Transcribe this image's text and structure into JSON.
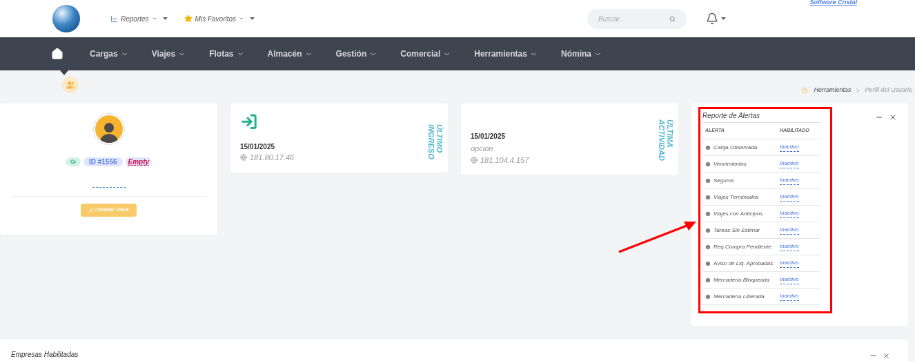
{
  "header": {
    "brand_caption": "Software Cristal",
    "quick_links": [
      {
        "label": "Reportes",
        "kind": "chart"
      },
      {
        "label": "Mis Favoritos",
        "kind": "star"
      }
    ],
    "search": {
      "placeholder": "Buscar..."
    }
  },
  "nav": {
    "items": [
      {
        "label": "Cargas"
      },
      {
        "label": "Viajes"
      },
      {
        "label": "Flotas"
      },
      {
        "label": "Almacén"
      },
      {
        "label": "Gestión"
      },
      {
        "label": "Comercial"
      },
      {
        "label": "Herramientas"
      },
      {
        "label": "Nómina"
      }
    ]
  },
  "breadcrumb": [
    "Herramientas",
    "Perfil del Usuario"
  ],
  "profile": {
    "id_badge": "ID #1556",
    "empty_badge": "Empty",
    "button": "Cambiar Clave"
  },
  "last_login": {
    "date": "15/01/2025",
    "ip": "181.80.17.46",
    "label_lines": [
      "ÚLTIMO",
      "INGRESO"
    ]
  },
  "last_activity": {
    "date": "15/01/2025",
    "detail": "opcion",
    "ip": "181.104.4.157",
    "label_lines": [
      "ÚLTIMA",
      "ACTIVIDAD"
    ]
  },
  "alerts": {
    "title": "Reporte de Alertas",
    "columns": [
      "ALERTA",
      "HABILITADO"
    ],
    "rows": [
      {
        "name": "Carga Observada",
        "status": "Inactivo"
      },
      {
        "name": "Vencimientos",
        "status": "Inactivo"
      },
      {
        "name": "Seguros",
        "status": "Inactivo"
      },
      {
        "name": "Viajes Terminados",
        "status": "Inactivo"
      },
      {
        "name": "Viajes con Anticipos",
        "status": "Inactivo"
      },
      {
        "name": "Tareas Sin Estimar",
        "status": "Inactivo"
      },
      {
        "name": "Req.Compra Pendiente",
        "status": "Inactivo"
      },
      {
        "name": "Aviso de Liq. Aprobadas",
        "status": "Inactivo"
      },
      {
        "name": "Mercadería Bloqueada",
        "status": "Inactivo"
      },
      {
        "name": "Mercadería Liberada",
        "status": "Inactivo"
      }
    ]
  },
  "companies": {
    "title": "Empresas Habilitadas"
  }
}
